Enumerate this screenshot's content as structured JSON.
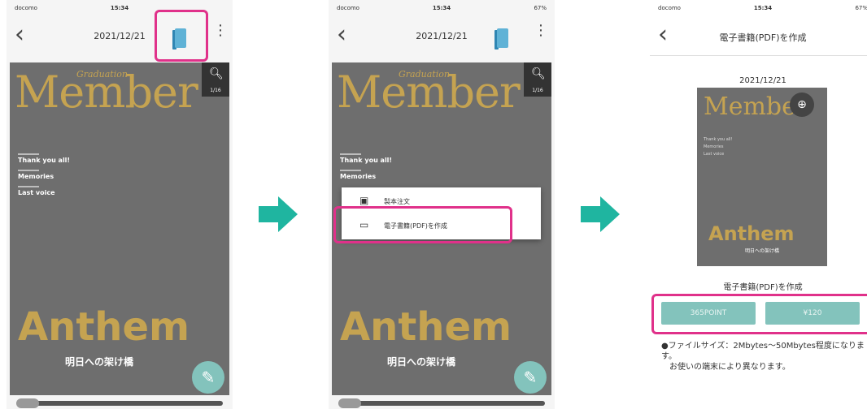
{
  "screens": [
    {
      "status": {
        "carrier": "docomo",
        "time": "15:34",
        "battery": ""
      },
      "nav_title": "2021/12/21",
      "magazine": {
        "brand": "Member",
        "brand_sub": "Graduation",
        "contents": [
          "Thank you all!",
          "Memories",
          "Last voice"
        ],
        "title": "Anthem",
        "subtitle": "明日への架け橋",
        "zoom_label": "1/16"
      }
    },
    {
      "status": {
        "carrier": "docomo",
        "time": "15:34",
        "battery": "67%"
      },
      "nav_title": "2021/12/21",
      "magazine": {
        "brand": "Member",
        "brand_sub": "Graduation",
        "contents": [
          "Thank you all!",
          "Memories"
        ],
        "title": "Anthem",
        "subtitle": "明日への架け橋",
        "zoom_label": "1/16"
      },
      "menu_items": [
        "製本注文",
        "電子書籍(PDF)を作成"
      ]
    },
    {
      "status": {
        "carrier": "docomo",
        "time": "15:34",
        "battery": "67%"
      },
      "nav_title": "電子書籍(PDF)を作成",
      "preview_date": "2021/12/21",
      "mini": {
        "brand": "Member",
        "lines": [
          "Thank you all!",
          "Memories",
          "Last voice"
        ],
        "title": "Anthem",
        "subtitle": "明日への架け橋"
      },
      "pdf_label": "電子書籍(PDF)を作成",
      "buttons": [
        "365POINT",
        "¥120"
      ],
      "note_line1": "●ファイルサイズ：2Mbytes〜50Mbytes程度になります。",
      "note_line2": "お使いの端末により異なります。"
    }
  ],
  "colors": {
    "highlight": "#e0318a",
    "arrow": "#1fb5a0",
    "accent": "#83c3bc",
    "gold": "#c5a351"
  },
  "icons": [
    "back-chevron-icon",
    "book-icon",
    "more-vertical-icon",
    "search-icon",
    "pencil-icon",
    "bind-icon",
    "pdf-icon"
  ]
}
